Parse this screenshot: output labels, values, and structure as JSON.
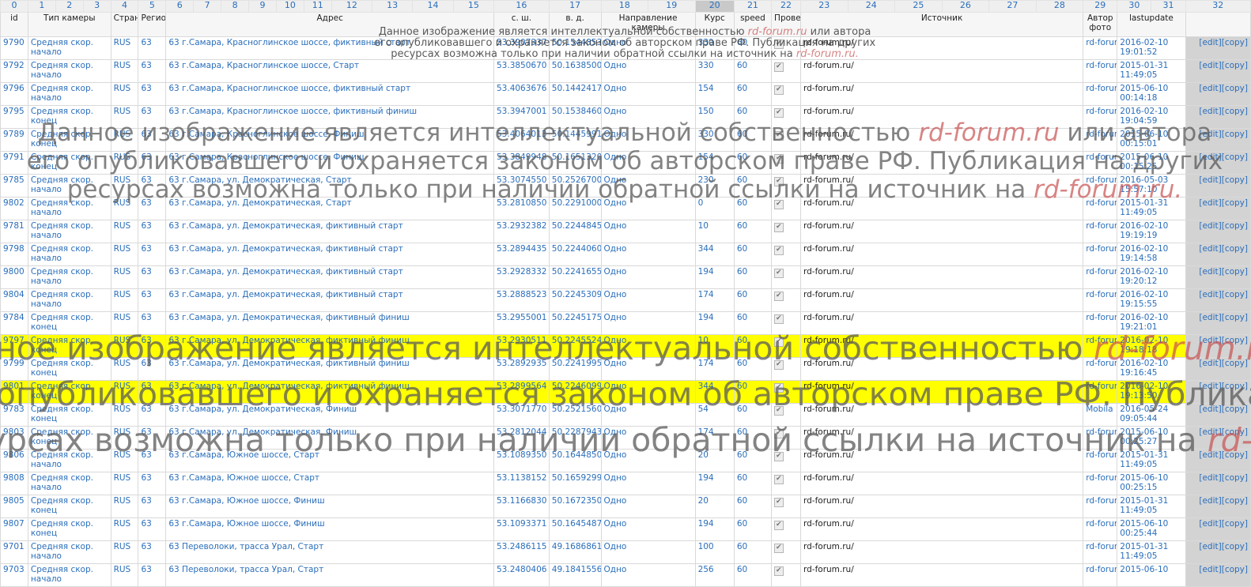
{
  "columns": [
    "0",
    "1",
    "2",
    "3",
    "4",
    "5",
    "6",
    "7",
    "8",
    "9",
    "10",
    "11",
    "12",
    "13",
    "14",
    "15",
    "16",
    "17",
    "18",
    "19",
    "20",
    "21",
    "22",
    "23",
    "24",
    "25",
    "26",
    "27",
    "28",
    "29",
    "30",
    "31",
    "32"
  ],
  "sorted_column": "20",
  "headers": {
    "id": "id",
    "type": "Тип камеры",
    "country": "Страна",
    "region": "Регион",
    "address": "Адрес",
    "lat": "с. ш.",
    "lon": "в. д.",
    "direction": "Направление камеры",
    "course": "Курс",
    "speed": "speed",
    "checked": "Проверено",
    "source": "Источник",
    "author": "Автор фото",
    "lastupdate": "lastupdate"
  },
  "edit_label": "[edit][copy]",
  "rows": [
    {
      "id": "9790",
      "type": "Средняя скор. начало",
      "country": "RUS",
      "region": "63",
      "address": "63 г.Самара, Красноглинское шоссе, фиктивный старт",
      "lat": "53.3907337",
      "lon": "50.1544853",
      "direction": "Одно",
      "course": "330",
      "speed": "60",
      "source": "rd-forum.ru/",
      "author": "rd-forum.ru/",
      "lastupdate": "2016-02-10 19:01:52",
      "hl": false
    },
    {
      "id": "9792",
      "type": "Средняя скор. начало",
      "country": "RUS",
      "region": "63",
      "address": "63 г.Самара, Красноглинское шоссе, Старт",
      "lat": "53.3850670",
      "lon": "50.1638500",
      "direction": "Одно",
      "course": "330",
      "speed": "60",
      "source": "rd-forum.ru/",
      "author": "rd-forum.ru/",
      "lastupdate": "2015-01-31 11:49:05",
      "hl": false
    },
    {
      "id": "9796",
      "type": "Средняя скор. начало",
      "country": "RUS",
      "region": "63",
      "address": "63 г.Самара, Красноглинское шоссе, фиктивный старт",
      "lat": "53.4063676",
      "lon": "50.1442417",
      "direction": "Одно",
      "course": "154",
      "speed": "60",
      "source": "rd-forum.ru/",
      "author": "rd-forum.ru/",
      "lastupdate": "2015-06-10 00:14:18",
      "hl": false
    },
    {
      "id": "9795",
      "type": "Средняя скор. конец",
      "country": "RUS",
      "region": "63",
      "address": "63 г.Самара, Красноглинское шоссе, фиктивный финиш",
      "lat": "53.3947001",
      "lon": "50.1538460",
      "direction": "Одно",
      "course": "150",
      "speed": "60",
      "source": "rd-forum.ru/",
      "author": "rd-forum.ru/",
      "lastupdate": "2016-02-10 19:04:59",
      "hl": false
    },
    {
      "id": "9789",
      "type": "Средняя скор. конец",
      "country": "RUS",
      "region": "63",
      "address": "63 г.Самара, Красноглинское шоссе, Финиш",
      "lat": "53.4064013",
      "lon": "50.1445991",
      "direction": "Одно",
      "course": "330",
      "speed": "60",
      "source": "rd-forum.ru/",
      "author": "rd-forum.ru/",
      "lastupdate": "2015-06-10 00:15:01",
      "hl": false
    },
    {
      "id": "9791",
      "type": "Средняя скор. конец",
      "country": "RUS",
      "region": "63",
      "address": "63 г.Самара, Красноглинское шоссе, Финиш",
      "lat": "53.3849948",
      "lon": "50.1651320",
      "direction": "Одно",
      "course": "154",
      "speed": "60",
      "source": "rd-forum.ru/",
      "author": "rd-forum.ru/",
      "lastupdate": "2015-06-10 00:15:25",
      "hl": false
    },
    {
      "id": "9785",
      "type": "Средняя скор. начало",
      "country": "RUS",
      "region": "63",
      "address": "63 г.Самара, ул. Демократическая, Старт",
      "lat": "53.3074550",
      "lon": "50.2526700",
      "direction": "Одно",
      "course": "230",
      "speed": "60",
      "source": "rd-forum.ru/",
      "author": "rd-forum.ru/",
      "lastupdate": "2016-05-03 15:57:10",
      "hl": false
    },
    {
      "id": "9802",
      "type": "Средняя скор. начало",
      "country": "RUS",
      "region": "63",
      "address": "63 г.Самара, ул. Демократическая, Старт",
      "lat": "53.2810850",
      "lon": "50.2291000",
      "direction": "Одно",
      "course": "0",
      "speed": "60",
      "source": "rd-forum.ru/",
      "author": "rd-forum.ru/",
      "lastupdate": "2015-01-31 11:49:05",
      "hl": false
    },
    {
      "id": "9781",
      "type": "Средняя скор. начало",
      "country": "RUS",
      "region": "63",
      "address": "63 г.Самара, ул. Демократическая, фиктивный старт",
      "lat": "53.2932382",
      "lon": "50.2244845",
      "direction": "Одно",
      "course": "10",
      "speed": "60",
      "source": "rd-forum.ru/",
      "author": "rd-forum.ru/",
      "lastupdate": "2016-02-10 19:19:19",
      "hl": false
    },
    {
      "id": "9798",
      "type": "Средняя скор. начало",
      "country": "RUS",
      "region": "63",
      "address": "63 г.Самара, ул. Демократическая, фиктивный старт",
      "lat": "53.2894435",
      "lon": "50.2244060",
      "direction": "Одно",
      "course": "344",
      "speed": "60",
      "source": "rd-forum.ru/",
      "author": "rd-forum.ru/",
      "lastupdate": "2016-02-10 19:14:58",
      "hl": false
    },
    {
      "id": "9800",
      "type": "Средняя скор. начало",
      "country": "RUS",
      "region": "63",
      "address": "63 г.Самара, ул. Демократическая, фиктивный старт",
      "lat": "53.2928332",
      "lon": "50.2241655",
      "direction": "Одно",
      "course": "194",
      "speed": "60",
      "source": "rd-forum.ru/",
      "author": "rd-forum.ru/",
      "lastupdate": "2016-02-10 19:20:12",
      "hl": false
    },
    {
      "id": "9804",
      "type": "Средняя скор. начало",
      "country": "RUS",
      "region": "63",
      "address": "63 г.Самара, ул. Демократическая, фиктивный старт",
      "lat": "53.2888523",
      "lon": "50.2245309",
      "direction": "Одно",
      "course": "174",
      "speed": "60",
      "source": "rd-forum.ru/",
      "author": "rd-forum.ru/",
      "lastupdate": "2016-02-10 19:15:55",
      "hl": false
    },
    {
      "id": "9784",
      "type": "Средняя скор. конец",
      "country": "RUS",
      "region": "63",
      "address": "63 г.Самара, ул. Демократическая, фиктивный финиш",
      "lat": "53.2955001",
      "lon": "50.2245175",
      "direction": "Одно",
      "course": "194",
      "speed": "60",
      "source": "rd-forum.ru/",
      "author": "rd-forum.ru/",
      "lastupdate": "2016-02-10 19:21:01",
      "hl": false
    },
    {
      "id": "9797",
      "type": "Средняя скор. конец",
      "country": "RUS",
      "region": "63",
      "address": "63 г.Самара, ул. Демократическая, фиктивный финиш",
      "lat": "53.2930511",
      "lon": "50.2245524",
      "direction": "Одно",
      "course": "10",
      "speed": "60",
      "source": "rd-forum.ru/",
      "author": "rd-forum.ru/",
      "lastupdate": "2016-02-10 19:18:18",
      "hl": true
    },
    {
      "id": "9799",
      "type": "Средняя скор. конец",
      "country": "RUS",
      "region": "63",
      "address": "63 г.Самара, ул. Демократическая, фиктивный финиш",
      "lat": "53.2892935",
      "lon": "50.2241995",
      "direction": "Одно",
      "course": "174",
      "speed": "60",
      "source": "rd-forum.ru/",
      "author": "rd-forum.ru/",
      "lastupdate": "2016-02-10 19:16:45",
      "hl": false
    },
    {
      "id": "9801",
      "type": "Средняя скор. конец",
      "country": "RUS",
      "region": "63",
      "address": "63 г.Самара, ул. Демократическая, фиктивный финиш",
      "lat": "53.2899564",
      "lon": "50.2246099",
      "direction": "Одно",
      "course": "344",
      "speed": "60",
      "source": "rd-forum.ru/",
      "author": "rd-forum.ru/",
      "lastupdate": "2016-02-10 19:13:50",
      "hl": true
    },
    {
      "id": "9783",
      "type": "Средняя скор. конец",
      "country": "RUS",
      "region": "63",
      "address": "63 г.Самара, ул. Демократическая, Финиш",
      "lat": "53.3071770",
      "lon": "50.2521560",
      "direction": "Одно",
      "course": "54",
      "speed": "60",
      "source": "rd-forum.ru/",
      "author": "Mobila",
      "lastupdate": "2016-05-24 09:05:44",
      "hl": false
    },
    {
      "id": "9803",
      "type": "Средняя скор. конец",
      "country": "RUS",
      "region": "63",
      "address": "63 г.Самара, ул. Демократическая, Финиш",
      "lat": "53.2812044",
      "lon": "50.2287943",
      "direction": "Одно",
      "course": "174",
      "speed": "60",
      "source": "rd-forum.ru/",
      "author": "rd-forum.ru/",
      "lastupdate": "2015-06-10 00:25:27",
      "hl": false
    },
    {
      "id": "9806",
      "type": "Средняя скор. начало",
      "country": "RUS",
      "region": "63",
      "address": "63 г.Самара, Южное шоссе, Старт",
      "lat": "53.1089350",
      "lon": "50.1644850",
      "direction": "Одно",
      "course": "20",
      "speed": "60",
      "source": "rd-forum.ru/",
      "author": "rd-forum.ru/",
      "lastupdate": "2015-01-31 11:49:05",
      "hl": false
    },
    {
      "id": "9808",
      "type": "Средняя скор. начало",
      "country": "RUS",
      "region": "63",
      "address": "63 г.Самара, Южное шоссе, Старт",
      "lat": "53.1138152",
      "lon": "50.1659299",
      "direction": "Одно",
      "course": "194",
      "speed": "60",
      "source": "rd-forum.ru/",
      "author": "rd-forum.ru/",
      "lastupdate": "2015-06-10 00:25:15",
      "hl": false
    },
    {
      "id": "9805",
      "type": "Средняя скор. конец",
      "country": "RUS",
      "region": "63",
      "address": "63 г.Самара, Южное шоссе, Финиш",
      "lat": "53.1166830",
      "lon": "50.1672350",
      "direction": "Одно",
      "course": "20",
      "speed": "60",
      "source": "rd-forum.ru/",
      "author": "rd-forum.ru/",
      "lastupdate": "2015-01-31 11:49:05",
      "hl": false
    },
    {
      "id": "9807",
      "type": "Средняя скор. конец",
      "country": "RUS",
      "region": "63",
      "address": "63 г.Самара, Южное шоссе, Финиш",
      "lat": "53.1093371",
      "lon": "50.1645487",
      "direction": "Одно",
      "course": "194",
      "speed": "60",
      "source": "rd-forum.ru/",
      "author": "rd-forum.ru/",
      "lastupdate": "2015-06-10 00:25:44",
      "hl": false
    },
    {
      "id": "9701",
      "type": "Средняя скор. начало",
      "country": "RUS",
      "region": "63",
      "address": "63 Переволоки, трасса Урал, Старт",
      "lat": "53.2486115",
      "lon": "49.1686861",
      "direction": "Одно",
      "course": "100",
      "speed": "60",
      "source": "rd-forum.ru/",
      "author": "rd-forum.ru/",
      "lastupdate": "2015-01-31 11:49:05",
      "hl": false
    },
    {
      "id": "9703",
      "type": "Средняя скор. начало",
      "country": "RUS",
      "region": "63",
      "address": "63 Переволоки, трасса Урал, Старт",
      "lat": "53.2480406",
      "lon": "49.1841556",
      "direction": "Одно",
      "course": "256",
      "speed": "60",
      "source": "rd-forum.ru/",
      "author": "rd-forum.ru/",
      "lastupdate": "2015-06-10",
      "hl": false
    }
  ],
  "watermark": {
    "line1": "Данное изображение является интеллектуальной собственностью",
    "brand": "rd-forum.ru",
    "line1_end": "или автора",
    "line2": "его опубликовавшего и охраняется законом об авторском праве РФ. Публикация на других",
    "line3": "ресурсах возможна только при наличии обратной ссылки на источник на",
    "brand_end": "rd-forum.ru."
  }
}
